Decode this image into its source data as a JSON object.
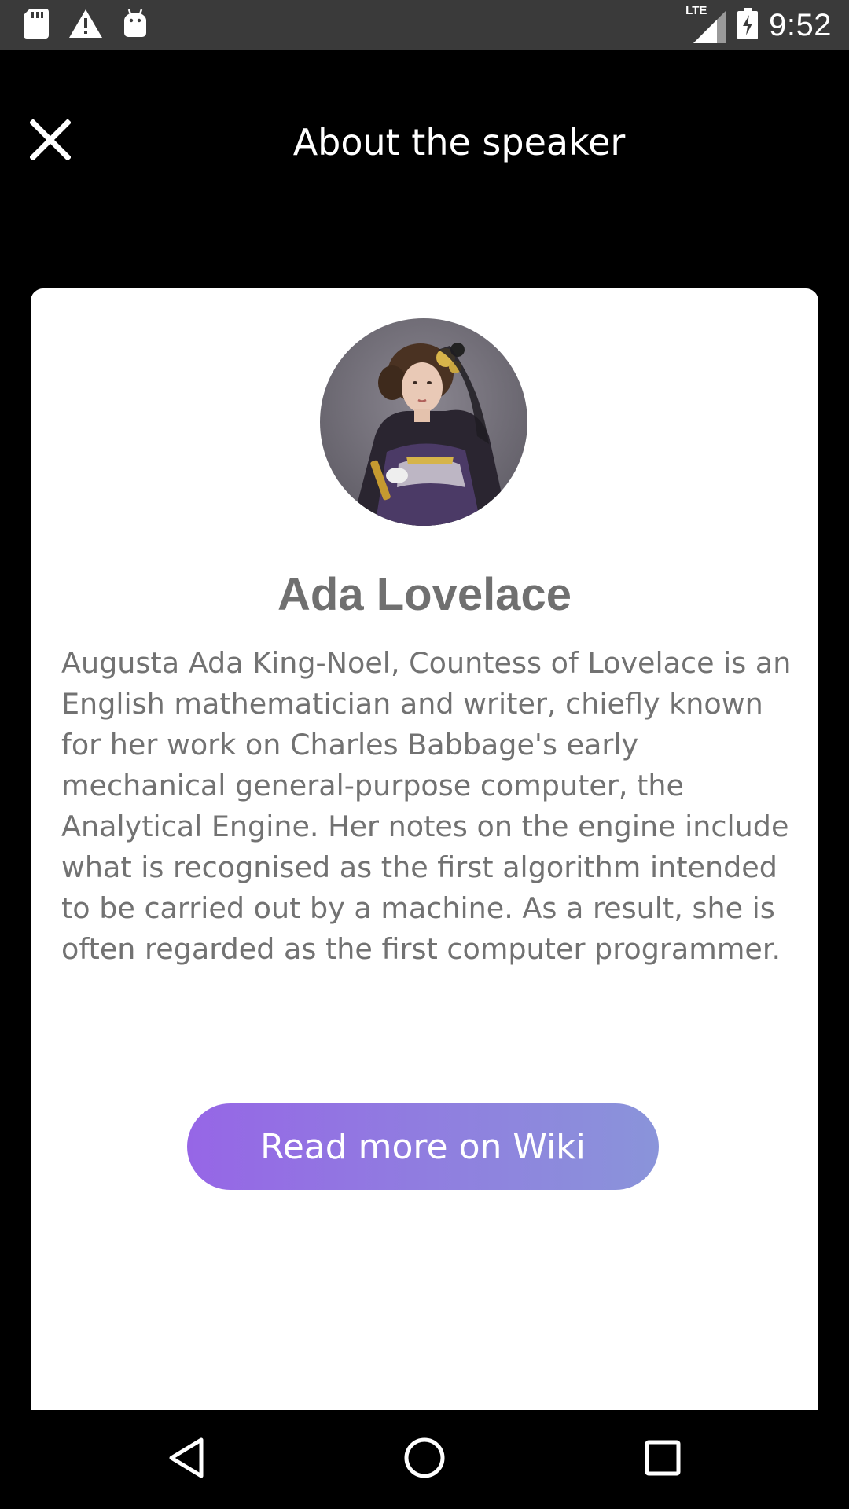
{
  "status_bar": {
    "time": "9:52",
    "network_label": "LTE",
    "left_icons": [
      "sd-card-icon",
      "warning-icon",
      "android-icon"
    ],
    "right_icons": [
      "signal-icon",
      "battery-charging-icon"
    ],
    "background": "#3a3a3a"
  },
  "header": {
    "title": "About the speaker",
    "close_icon": "close-icon"
  },
  "speaker": {
    "name": "Ada Lovelace",
    "bio": "Augusta Ada King-Noel, Countess of Lovelace is an English mathematician and writer, chiefly known for her work on Charles Babbage's early mechanical general-purpose computer, the Analytical Engine. Her notes on the engine include what is recognised as the first algorithm intended to be carried out by a machine. As a result, she is often regarded as the first computer programmer.",
    "wiki_button_label": "Read more on Wiki"
  },
  "nav_bar": {
    "back_icon": "back-triangle-icon",
    "home_icon": "home-circle-icon",
    "recents_icon": "recents-square-icon"
  },
  "colors": {
    "background": "#000000",
    "card": "#ffffff",
    "text_gray": "#727272",
    "button_gradient_start": "#9666e6",
    "button_gradient_end": "#8a94da"
  }
}
